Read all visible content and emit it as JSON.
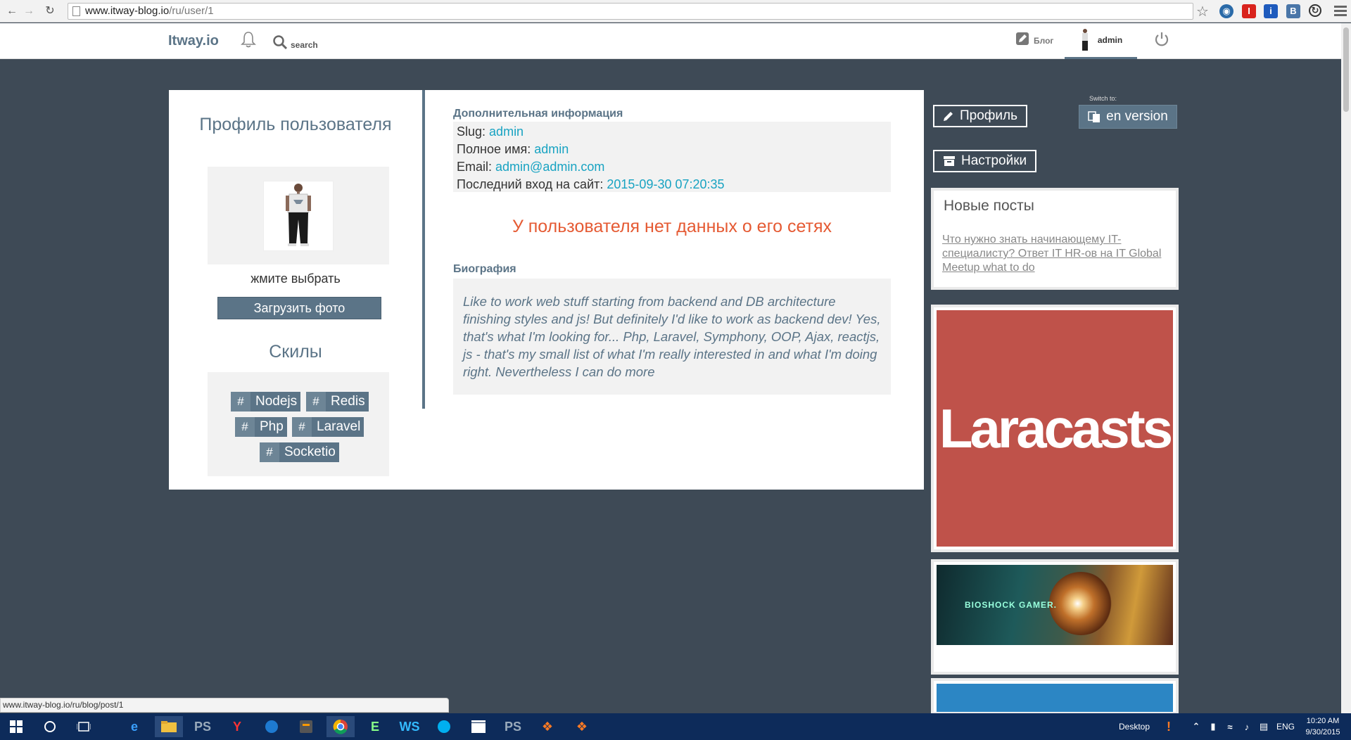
{
  "browser": {
    "url_host": "www.itway-blog.io",
    "url_path": "/ru/user/1"
  },
  "site_nav": {
    "logo": "Itway.io",
    "search_label": "search",
    "blog_label": "Блог",
    "user_label": "admin"
  },
  "profile": {
    "title": "Профиль пользователя",
    "choose_text": "жмите выбрать",
    "upload_button": "Загрузить фото",
    "skills_title": "Скилы",
    "skills": [
      "Nodejs",
      "Redis",
      "Php",
      "Laravel",
      "Socketio"
    ],
    "skill_hash": "#"
  },
  "info": {
    "section_title": "Дополнительная информация",
    "rows": [
      {
        "label": "Slug:",
        "value": "admin"
      },
      {
        "label": "Полное имя:",
        "value": "admin"
      },
      {
        "label": "Email:",
        "value": "admin@admin.com"
      },
      {
        "label": "Последний вход на сайт:",
        "value": "2015-09-30 07:20:35"
      }
    ],
    "no_social": "У пользователя нет данных о его сетях",
    "bio_title": "Биография",
    "bio_text": "Like to work web stuff starting from backend and DB architecture finishing styles and js! But definitely I'd like to work as backend dev! Yes, that's what I'm looking for... Php, Laravel, Symphony, OOP, Ajax, reactjs, js - that's my small list of what I'm really interested in and what I'm doing right. Nevertheless I can do more"
  },
  "sidebar": {
    "profile_button": "Профиль",
    "switch_label": "Switch to:",
    "en_button": "en version",
    "settings_button": "Настройки",
    "new_posts_title": "Новые посты",
    "new_post_link": "Что нужно знать начинающему IT-специалисту? Ответ IT HR-ов на IT Global Meetup what to do",
    "ad1_text": "Laracasts",
    "ad2_text": "BIOSHOCK GAMER."
  },
  "status_url": "www.itway-blog.io/ru/blog/post/1",
  "taskbar": {
    "desktop_label": "Desktop",
    "lang": "ENG",
    "time": "10:20 AM",
    "date": "9/30/2015"
  }
}
